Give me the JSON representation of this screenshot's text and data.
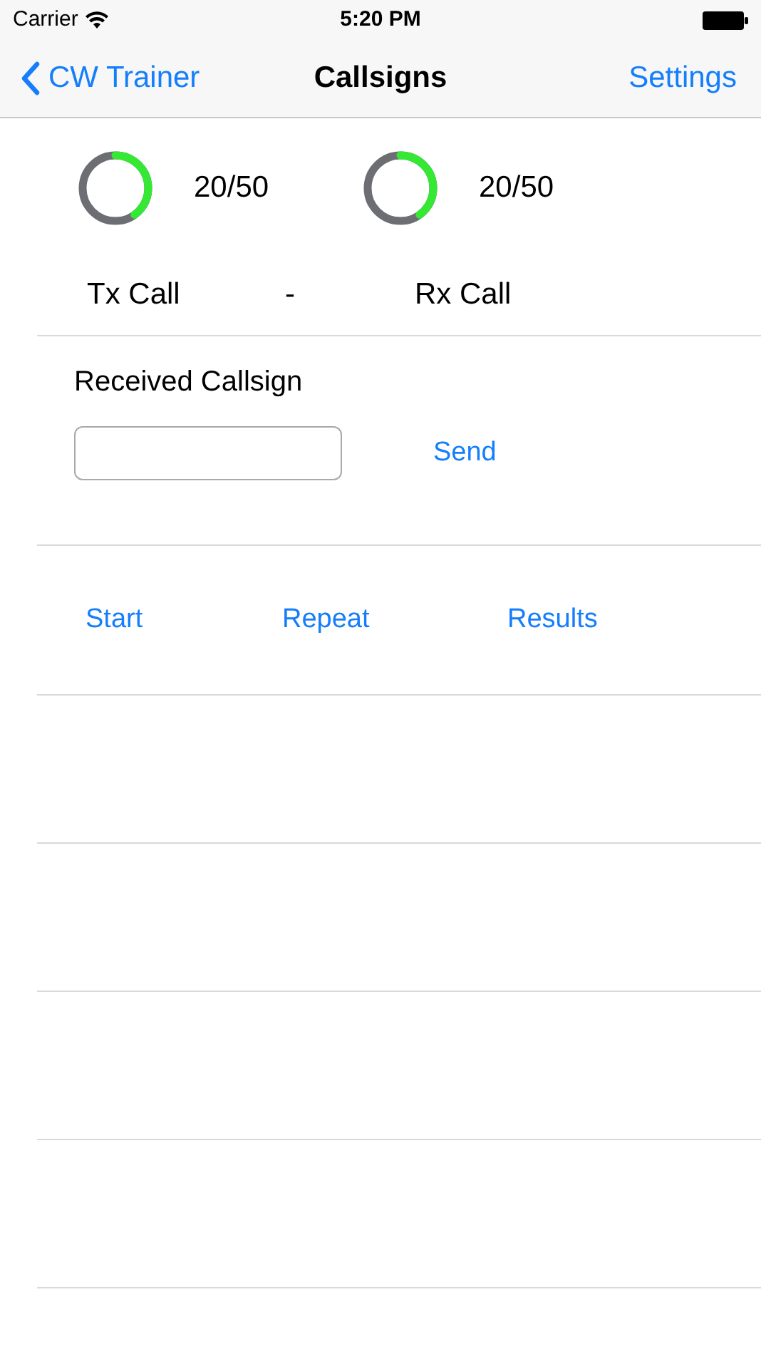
{
  "status_bar": {
    "carrier": "Carrier",
    "time": "5:20 PM"
  },
  "nav_bar": {
    "back": "CW Trainer",
    "title": "Callsigns",
    "action": "Settings"
  },
  "progress": [
    {
      "level": 0.4,
      "reading": "20/50"
    },
    {
      "level": 0.4,
      "reading": "20/50"
    }
  ],
  "calls": {
    "tx": "Tx Call",
    "separator": "-",
    "rx": "Rx Call"
  },
  "received": {
    "label": "Received Callsign",
    "send": "Send"
  },
  "actions": [
    "Start",
    "Repeat",
    "Results"
  ]
}
